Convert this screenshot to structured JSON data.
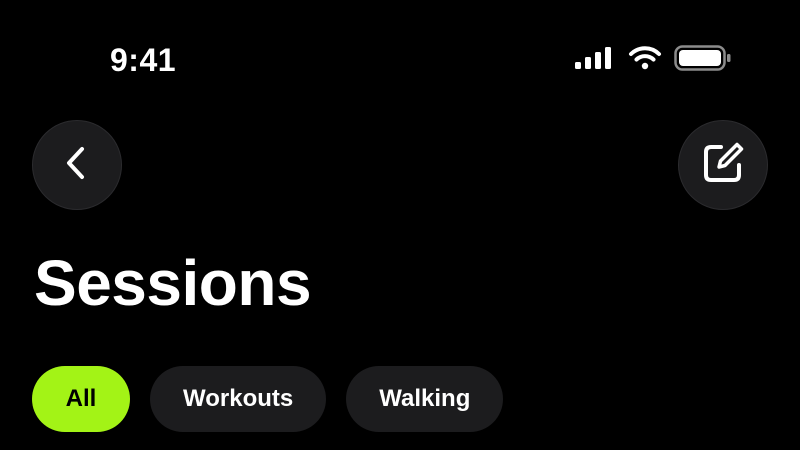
{
  "status_bar": {
    "time": "9:41",
    "icons": [
      "cellular-signal-icon",
      "wifi-icon",
      "battery-icon"
    ]
  },
  "nav": {
    "back_icon": "chevron-left-icon",
    "compose_icon": "compose-icon"
  },
  "header": {
    "title": "Sessions"
  },
  "filters": {
    "chips": [
      {
        "label": "All",
        "selected": true
      },
      {
        "label": "Workouts",
        "selected": false
      },
      {
        "label": "Walking",
        "selected": false
      }
    ]
  },
  "colors": {
    "background": "#000000",
    "accent": "#a3f316",
    "chip_background": "#1c1c1e",
    "text": "#ffffff"
  }
}
